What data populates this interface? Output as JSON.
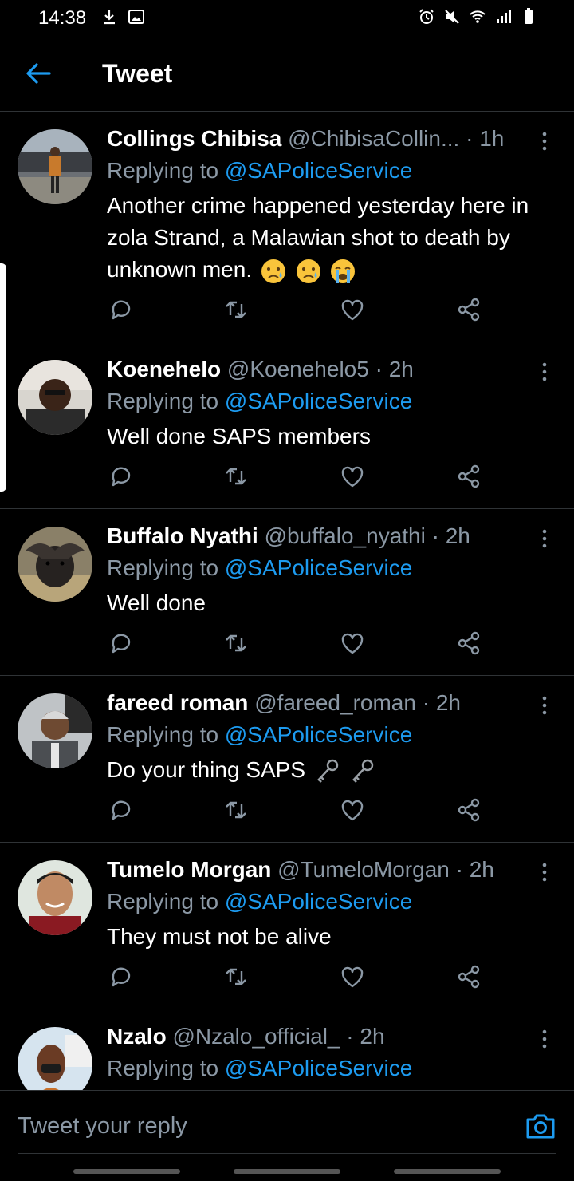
{
  "status_bar": {
    "time": "14:38",
    "left_icons": [
      "download-icon",
      "image-icon"
    ],
    "right_icons": [
      "alarm-icon",
      "mute-icon",
      "wifi-icon",
      "signal-icon",
      "battery-icon"
    ]
  },
  "header": {
    "title": "Tweet",
    "back_icon": "arrow-left-icon"
  },
  "tweets": [
    {
      "name": "Collings Chibisa",
      "handle": "@ChibisaCollin...",
      "dot": "·",
      "time": "1h",
      "replying_prefix": "Replying to ",
      "replying_to": "@SAPoliceService",
      "text": "Another crime happened yesterday here in zola Strand, a Malawian shot to death by unknown men.",
      "emojis": [
        "sad-relieved-face",
        "sad-relieved-face",
        "loudly-crying-face"
      ]
    },
    {
      "name": "Koenehelo",
      "handle": "@Koenehelo5",
      "dot": "·",
      "time": "2h",
      "replying_prefix": "Replying to ",
      "replying_to": "@SAPoliceService",
      "text": "Well done SAPS members"
    },
    {
      "name": "Buffalo Nyathi",
      "handle": "@buffalo_nyathi",
      "dot": "·",
      "time": "2h",
      "replying_prefix": "Replying to ",
      "replying_to": "@SAPoliceService",
      "text": "Well done"
    },
    {
      "name": "fareed roman",
      "handle": "@fareed_roman",
      "dot": "·",
      "time": "2h",
      "replying_prefix": "Replying to ",
      "replying_to": "@SAPoliceService",
      "text": "Do your thing SAPS",
      "emojis": [
        "key-icon",
        "key-icon"
      ]
    },
    {
      "name": "Tumelo Morgan",
      "handle": "@TumeloMorgan",
      "dot": "·",
      "time": "2h",
      "replying_prefix": "Replying to ",
      "replying_to": "@SAPoliceService",
      "text": "They must not be alive"
    },
    {
      "name": "Nzalo",
      "handle": "@Nzalo_official_",
      "dot": "·",
      "time": "2h",
      "replying_prefix": "Replying to ",
      "replying_to": "@SAPoliceService",
      "text": ""
    }
  ],
  "actions": [
    "reply-icon",
    "retweet-icon",
    "like-icon",
    "share-icon"
  ],
  "composer": {
    "placeholder": "Tweet your reply",
    "camera_icon": "camera-icon"
  },
  "colors": {
    "background": "#000000",
    "accent": "#1d9bf0",
    "muted": "#8b98a5",
    "divider": "#2f3336"
  }
}
